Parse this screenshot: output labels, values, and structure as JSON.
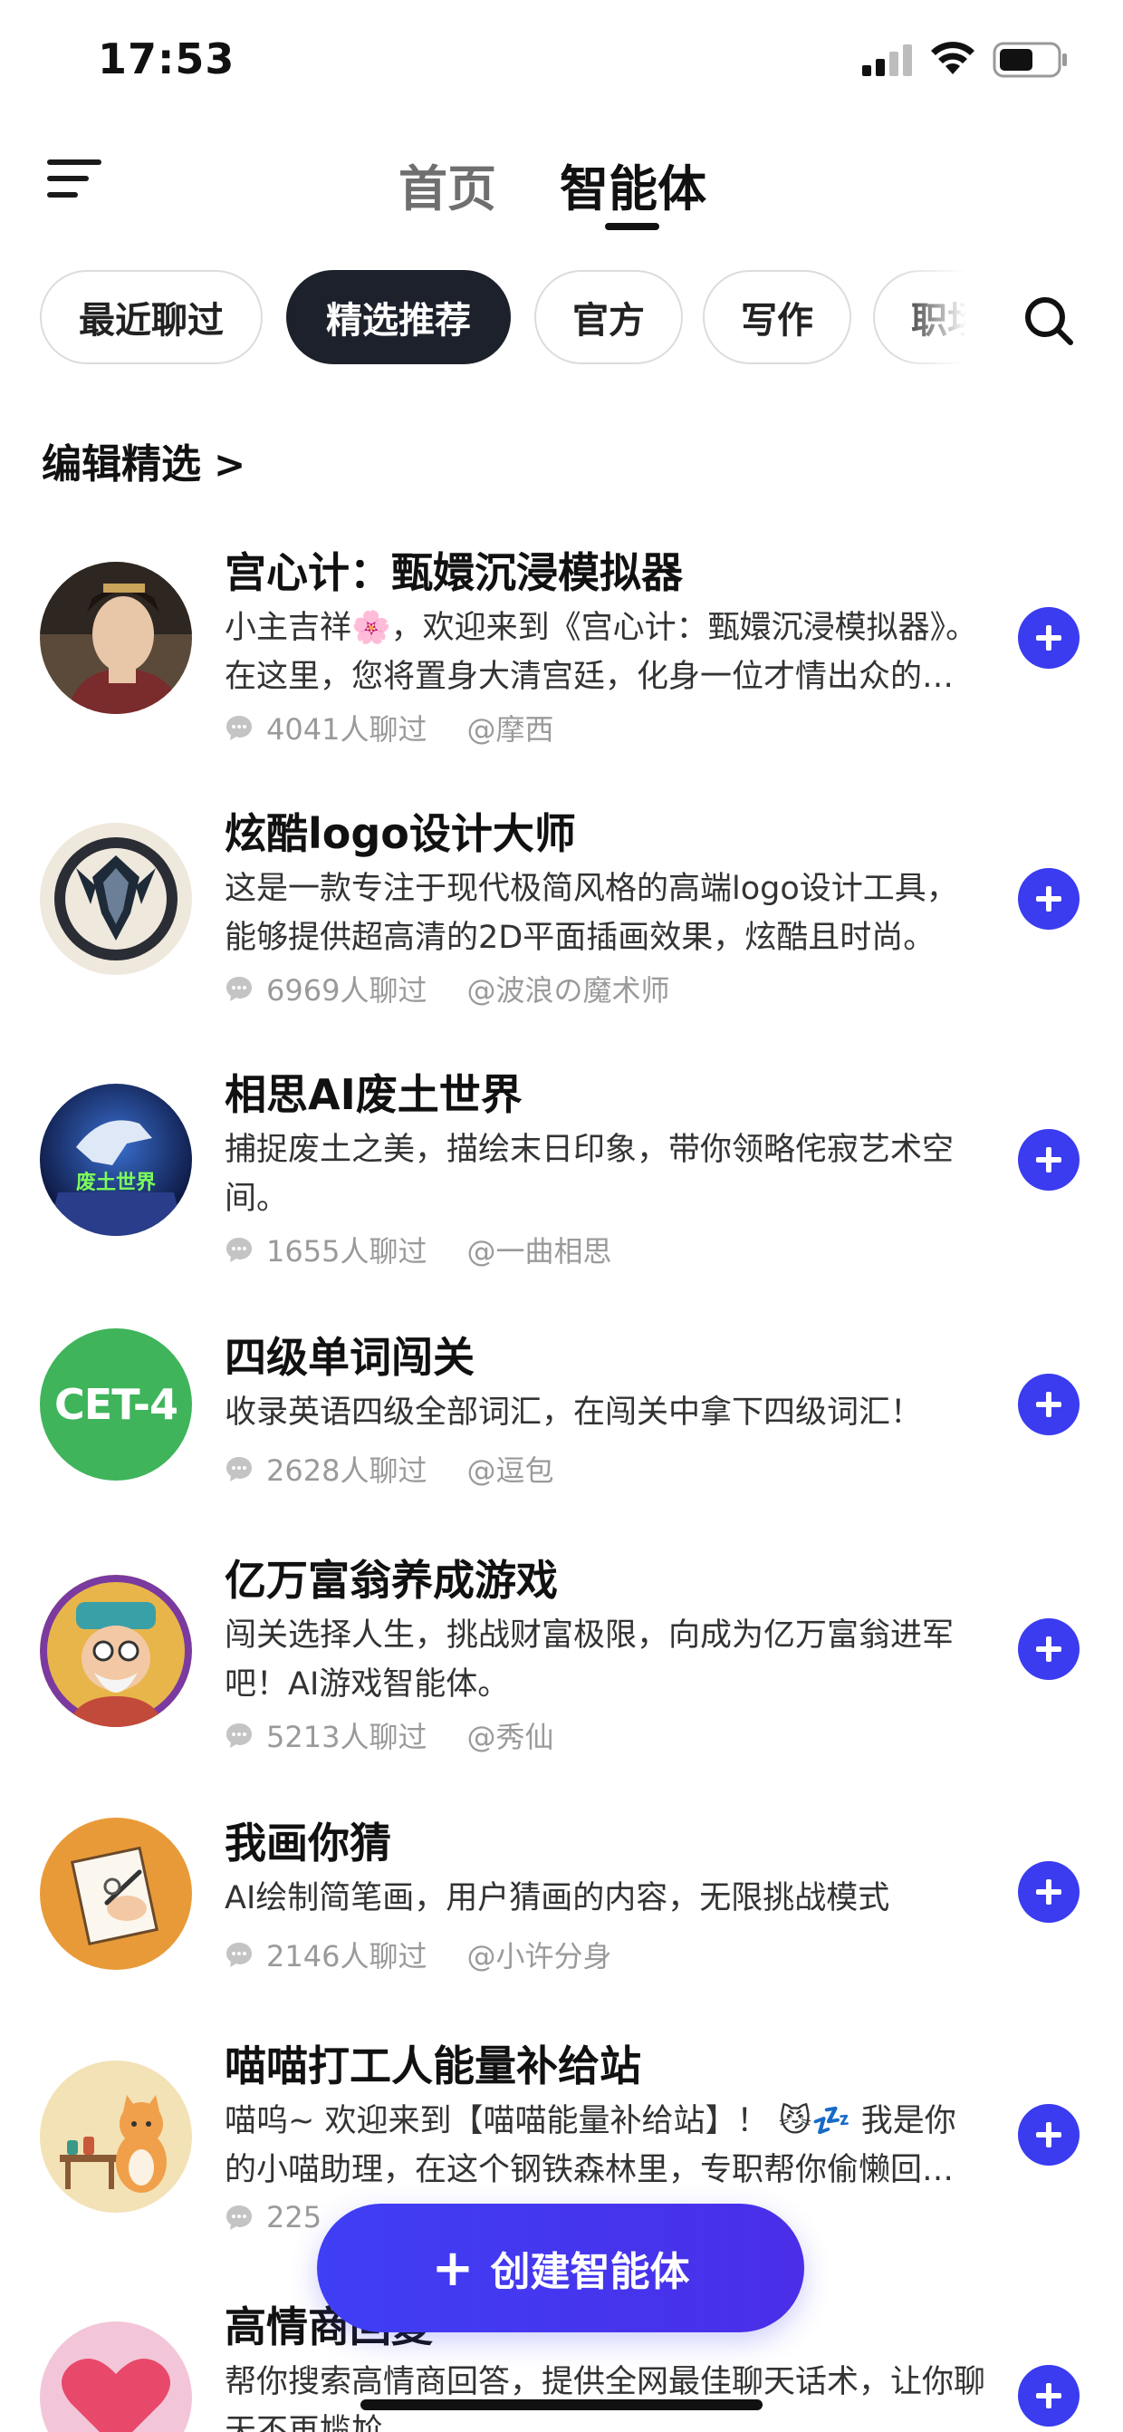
{
  "status_bar": {
    "time": "17:53"
  },
  "header": {
    "tabs": [
      "首页",
      "智能体"
    ],
    "active_tab": "智能体"
  },
  "chips": [
    "最近聊过",
    "精选推荐",
    "官方",
    "写作",
    "职场"
  ],
  "active_chip": "精选推荐",
  "section": {
    "title": "编辑精选",
    "chevron": ">"
  },
  "agents": [
    {
      "title": "宫心计：甄嬛沉浸模拟器",
      "desc": "小主吉祥🌸，欢迎来到《宫心计：甄嬛沉浸模拟器》。 在这里，您将置身大清宫廷，化身一位才情出众的小主……",
      "chats": "4041人聊过",
      "author": "@摩西"
    },
    {
      "title": "炫酷logo设计大师",
      "desc": "这是一款专注于现代极简风格的高端logo设计工具，能够提供超高清的2D平面插画效果，炫酷且时尚。",
      "chats": "6969人聊过",
      "author": "@波浪の魔术师"
    },
    {
      "title": "相思AI废土世界",
      "desc": "捕捉废土之美，描绘末日印象，带你领略侘寂艺术空间。",
      "chats": "1655人聊过",
      "author": "@一曲相思",
      "avatar_text": "废土世界"
    },
    {
      "title": "四级单词闯关",
      "desc": "收录英语四级全部词汇，在闯关中拿下四级词汇！",
      "chats": "2628人聊过",
      "author": "@逗包",
      "avatar_text": "CET-4"
    },
    {
      "title": "亿万富翁养成游戏",
      "desc": "闯关选择人生，挑战财富极限，向成为亿万富翁进军吧！AI游戏智能体。",
      "chats": "5213人聊过",
      "author": "@秀仙"
    },
    {
      "title": "我画你猜",
      "desc": "AI绘制简笔画，用户猜画的内容，无限挑战模式",
      "chats": "2146人聊过",
      "author": "@小许分身"
    },
    {
      "title": "喵喵打工人能量补给站",
      "desc": "喵呜~ 欢迎来到【喵喵能量补给站】！ 😼💤 我是你的小喵助理，在这个钢铁森林里，专职帮你偷懒回血……",
      "chats": "225",
      "author": ""
    },
    {
      "title": "高情商回复",
      "desc": "帮你搜索高情商回答，提供全网最佳聊天话术，让你聊天不再尴尬",
      "chats": "",
      "author": ""
    }
  ],
  "create_button": {
    "label": "创建智能体"
  },
  "colors": {
    "accent": "#3b3bf0",
    "chip_active": "#1c212b"
  }
}
